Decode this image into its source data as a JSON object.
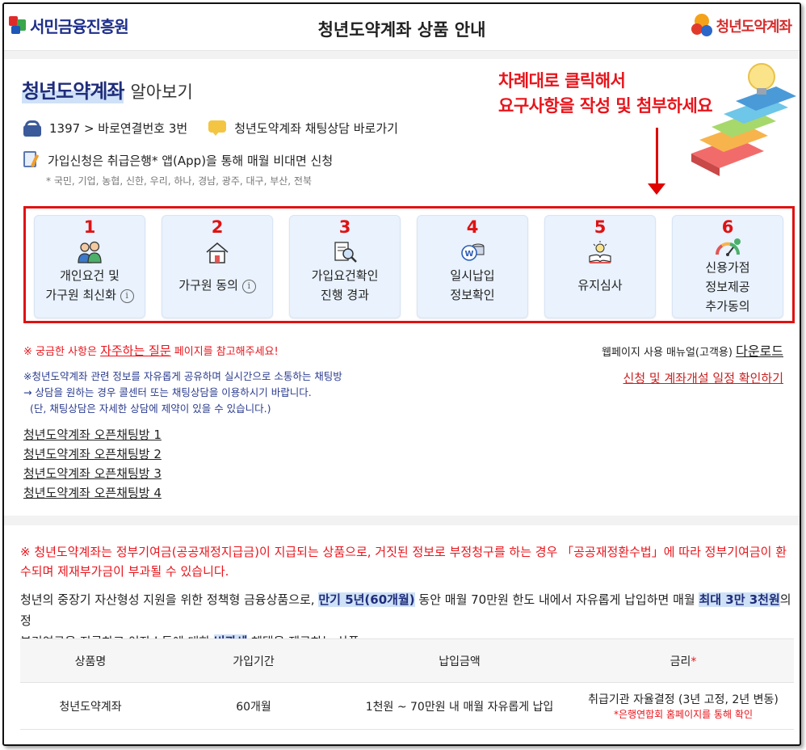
{
  "header": {
    "left_logo": "서민금융진흥원",
    "title": "청년도약계좌 상품 안내",
    "right_logo": "청년도약계좌"
  },
  "intro": {
    "title_main": "청년도약계좌",
    "title_sub": "알아보기",
    "phone": "1397 > 바로연결번호 3번",
    "chat_link": "청년도약계좌 채팅상담 바로가기",
    "apply": "가입신청은 취급은행* 앱(App)을 통해 매월 비대면 신청",
    "banks": "* 국민, 기업, 농협, 신한, 우리, 하나, 경남, 광주, 대구, 부산, 전북"
  },
  "instruction": {
    "line1": "차례대로 클릭해서",
    "line2": "요구사항을 작성 및 첨부하세요"
  },
  "steps": [
    {
      "num": "1",
      "line1": "개인요건 및",
      "line2": "가구원 최신화",
      "icon": "people-icon"
    },
    {
      "num": "2",
      "line1": "가구원 동의",
      "line2": "",
      "icon": "house-icon"
    },
    {
      "num": "3",
      "line1": "가입요건확인",
      "line2": "진행 경과",
      "icon": "document-search-icon"
    },
    {
      "num": "4",
      "line1": "일시납입",
      "line2": "정보확인",
      "icon": "coins-icon"
    },
    {
      "num": "5",
      "line1": "유지심사",
      "line2": "",
      "icon": "lightbulb-book-icon"
    },
    {
      "num": "6",
      "line1": "신용가점",
      "line2": "정보제공",
      "line3": "추가동의",
      "icon": "gauge-icon"
    }
  ],
  "info_glyph": "i",
  "notes": {
    "faq_prefix": "※ 궁금한 사항은",
    "faq_link": "자주하는 질문",
    "faq_suffix": "페이지를 참고해주세요!",
    "manual_prefix": "웹페이지 사용 매뉴얼(고객용)",
    "manual_link": "다운로드",
    "schedule_link": "신청 및 계좌개설 일정 확인하기",
    "chat_line1": "※청년도약계좌 관련 정보를 자유롭게 공유하며 실시간으로 소통하는 채팅방",
    "chat_line2": "→ 상담을 원하는 경우 콜센터 또는 채팅상담을 이용하시기 바랍니다.",
    "chat_line3": "(단, 채팅상담은 자세한 상담에 제약이 있을 수 있습니다.)"
  },
  "open_chats": [
    "청년도약계좌 오픈채팅방 1",
    "청년도약계좌 오픈채팅방 2",
    "청년도약계좌 오픈채팅방 3",
    "청년도약계좌 오픈채팅방 4"
  ],
  "warning": {
    "line1": "※ 청년도약계좌는 정부기여금(공공재정지급금)이 지급되는 상품으로, 거짓된 정보로 부정청구를 하는 경우 「공공재정환수법」에 따라 정부기여금이 환",
    "line2": "수되며 제재부가금이 부과될 수 있습니다."
  },
  "description": {
    "part1": "청년의 중장기 자산형성 지원을 위한 정책형 금융상품으로,",
    "hl1": "만기 5년(60개월)",
    "part2": "동안 매월 70만원 한도 내에서 자유롭게 납입하면 매월",
    "hl2": "최대 3만 3천원",
    "part3": "의 정",
    "part4": "부기여금을 지급하고 이자소득에 대한",
    "hl3": "비과세",
    "part5": "혜택을 제공하는 상품"
  },
  "table": {
    "headers": [
      "상품명",
      "가입기간",
      "납입금액",
      "금리"
    ],
    "required_mark": "*",
    "row": {
      "name": "청년도약계좌",
      "period": "60개월",
      "amount": "1천원 ~ 70만원 내 매월 자유롭게 납입",
      "rate": "취급기관 자율결정 (3년 고정, 2년 변동)",
      "rate_note": "*은행연합회 홈페이지를 통해 확인"
    }
  },
  "colors": {
    "accent_red": "#e8141b",
    "navy": "#1f2d7a",
    "highlight": "#cfe1f7",
    "step_bg": "#e9f2fd"
  }
}
